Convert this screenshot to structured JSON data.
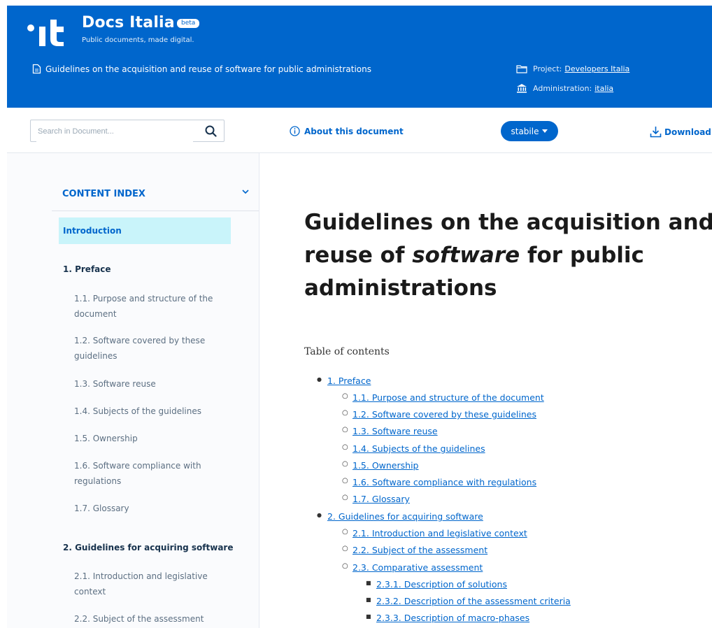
{
  "header": {
    "brand_title": "Docs Italia",
    "badge": "beta",
    "tagline": "Public documents, made digital.",
    "document_title": "Guidelines on the acquisition and reuse of software for public administrations",
    "project_label": "Project:",
    "project_value": "Developers Italia",
    "admin_label": "Administration:",
    "admin_value": "italia",
    "brand_color": "#0066cc"
  },
  "toolbar": {
    "search_placeholder": "Search in Document...",
    "about_label": "About this document",
    "version_label": "stabile",
    "download_label": "Download"
  },
  "sidebar": {
    "index_title": "CONTENT INDEX",
    "active_item": "Introduction",
    "sections": [
      {
        "title": "1. Preface",
        "items": [
          "1.1. Purpose and structure of the document",
          "1.2. Software covered by these guidelines",
          "1.3. Software reuse",
          "1.4. Subjects of the guidelines",
          "1.5. Ownership",
          "1.6. Software compliance with regulations",
          "1.7. Glossary"
        ]
      },
      {
        "title": "2. Guidelines for acquiring software",
        "items": [
          "2.1. Introduction and legislative context",
          "2.2. Subject of the assessment"
        ]
      }
    ]
  },
  "main": {
    "title_part1": "Guidelines on the acquisition and reuse of ",
    "title_em": "software",
    "title_part2": " for public administrations",
    "toc_heading": "Table of contents",
    "toc": [
      "1. Preface",
      "1.1. Purpose and structure of the document",
      "1.2. Software covered by these guidelines",
      "1.3. Software reuse",
      "1.4. Subjects of the guidelines",
      "1.5. Ownership",
      "1.6. Software compliance with regulations",
      "1.7. Glossary",
      "2. Guidelines for acquiring software",
      "2.1. Introduction and legislative context",
      "2.2. Subject of the assessment",
      "2.3. Comparative assessment",
      "2.3.1. Description of solutions",
      "2.3.2. Description of the assessment criteria",
      "2.3.3. Description of macro-phases"
    ]
  }
}
